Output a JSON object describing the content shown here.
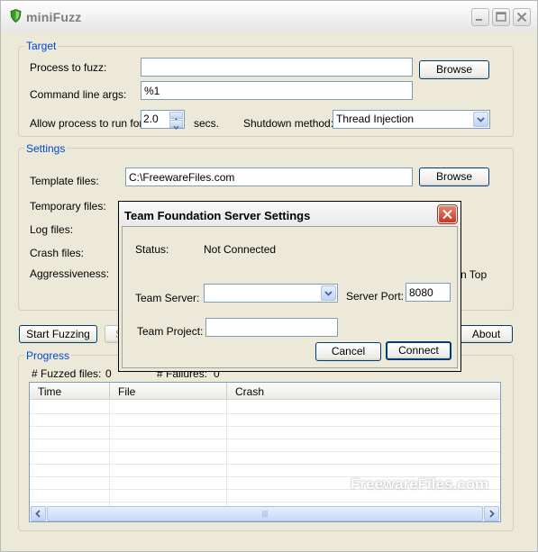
{
  "window": {
    "title": "miniFuzz"
  },
  "target": {
    "group_title": "Target",
    "process_label": "Process to fuzz:",
    "process_value": "",
    "browse_label": "Browse",
    "cmdline_label": "Command line args:",
    "cmdline_value": "%1",
    "allow_label": "Allow process to run for:",
    "allow_value": "2.0",
    "secs_label": "secs.",
    "shutdown_label": "Shutdown method:",
    "shutdown_value": "Thread Injection"
  },
  "settings": {
    "group_title": "Settings",
    "template_label": "Template files:",
    "template_value": "C:\\FreewareFiles.com",
    "browse_label": "Browse",
    "temporary_label": "Temporary files:",
    "log_label": "Log files:",
    "crash_label": "Crash files:",
    "aggressiveness_label": "Aggressiveness:",
    "on_top_fragment": "n Top"
  },
  "actions": {
    "start_label": "Start Fuzzing",
    "stop_fragment": "S",
    "about_label": "About"
  },
  "progress": {
    "group_title": "Progress",
    "fuzzed_label": "# Fuzzed files:",
    "fuzzed_value": "0",
    "failures_label": "# Failures:",
    "failures_value": "0",
    "columns": [
      "Time",
      "File",
      "Crash"
    ],
    "scroll_grip": "|||"
  },
  "dialog": {
    "title": "Team Foundation Server Settings",
    "status_label": "Status:",
    "status_value": "Not Connected",
    "server_label": "Team Server:",
    "server_value": "",
    "port_label": "Server Port:",
    "port_value": "8080",
    "project_label": "Team Project:",
    "project_value": "",
    "cancel_label": "Cancel",
    "connect_label": "Connect"
  },
  "watermark": "FreewareFiles.com",
  "colors": {
    "group_title": "#0046d5",
    "window_bg": "#ece9d8",
    "close_button": "#d9452c"
  }
}
